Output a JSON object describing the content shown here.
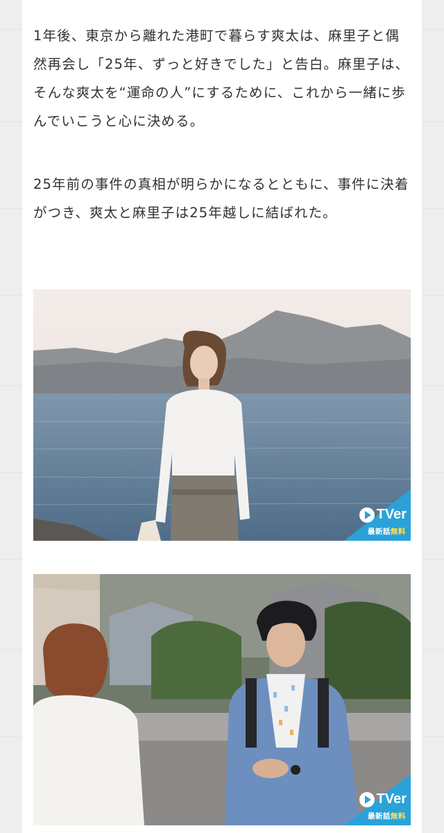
{
  "article": {
    "paragraphs": [
      "1年後、東京から離れた港町で暮らす爽太は、麻里子と偶然再会し「25年、ずっと好きでした」と告白。麻里子は、そんな爽太を“運命の人”にするために、これから一緒に歩んでいこうと心に決める。",
      "25年前の事件の真相が明らかになるとともに、事件に決着がつき、爽太と麻里子は25年越しに結ばれた。"
    ]
  },
  "images": [
    {
      "scene": "photo",
      "badge": {
        "logo": "TVer",
        "label_prefix": "最新話",
        "label_free": "無料"
      }
    },
    {
      "scene": "photo",
      "badge": {
        "logo": "TVer",
        "label_prefix": "最新話",
        "label_free": "無料"
      }
    }
  ],
  "colors": {
    "background": "#eeeeee",
    "card": "#ffffff",
    "text": "#333333",
    "badge_blue": "#2aa2d8",
    "badge_free": "#ffe35a"
  }
}
